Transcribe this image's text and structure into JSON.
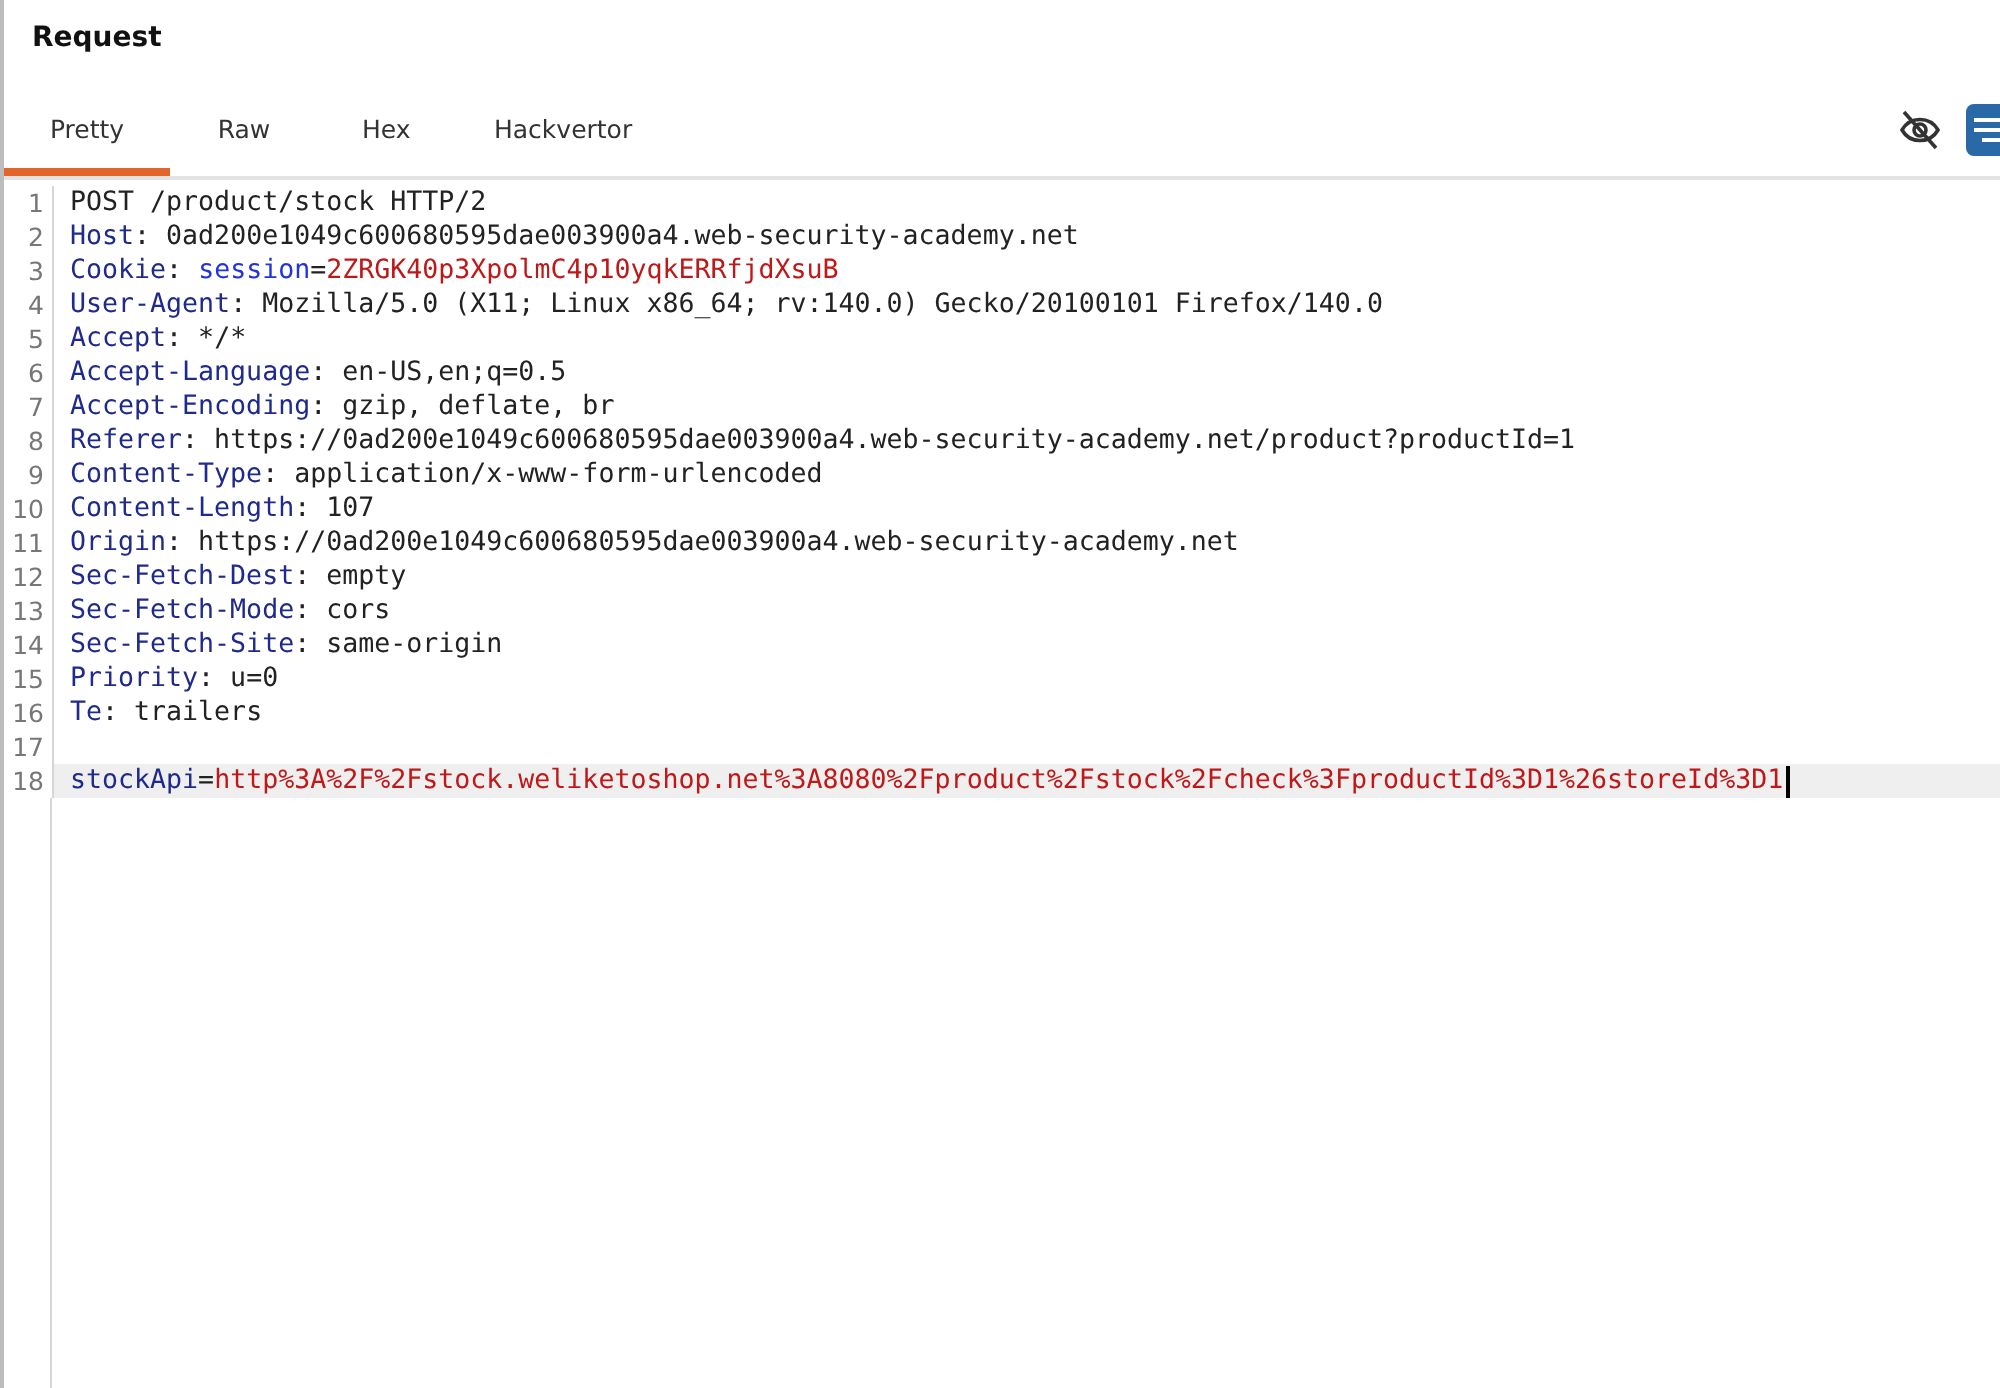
{
  "panel": {
    "title": "Request"
  },
  "tabs": [
    {
      "label": "Pretty",
      "selected": true
    },
    {
      "label": "Raw",
      "selected": false
    },
    {
      "label": "Hex",
      "selected": false
    },
    {
      "label": "Hackvertor",
      "selected": false
    }
  ],
  "editor": {
    "lines": [
      {
        "number": "1",
        "current": false,
        "segments": [
          {
            "kind": "plain",
            "text": "POST /product/stock HTTP/2"
          }
        ]
      },
      {
        "number": "2",
        "current": false,
        "segments": [
          {
            "kind": "name",
            "text": "Host"
          },
          {
            "kind": "plain",
            "text": ": 0ad200e1049c600680595dae003900a4.web-security-academy.net"
          }
        ]
      },
      {
        "number": "3",
        "current": false,
        "segments": [
          {
            "kind": "name",
            "text": "Cookie"
          },
          {
            "kind": "plain",
            "text": ": "
          },
          {
            "kind": "param",
            "text": "session"
          },
          {
            "kind": "plain",
            "text": "="
          },
          {
            "kind": "value",
            "text": "2ZRGK40p3XpolmC4p10yqkERRfjdXsuB"
          }
        ]
      },
      {
        "number": "4",
        "current": false,
        "segments": [
          {
            "kind": "name",
            "text": "User-Agent"
          },
          {
            "kind": "plain",
            "text": ": Mozilla/5.0 (X11; Linux x86_64; rv:140.0) Gecko/20100101 Firefox/140.0"
          }
        ]
      },
      {
        "number": "5",
        "current": false,
        "segments": [
          {
            "kind": "name",
            "text": "Accept"
          },
          {
            "kind": "plain",
            "text": ": */*"
          }
        ]
      },
      {
        "number": "6",
        "current": false,
        "segments": [
          {
            "kind": "name",
            "text": "Accept-Language"
          },
          {
            "kind": "plain",
            "text": ": en-US,en;q=0.5"
          }
        ]
      },
      {
        "number": "7",
        "current": false,
        "segments": [
          {
            "kind": "name",
            "text": "Accept-Encoding"
          },
          {
            "kind": "plain",
            "text": ": gzip, deflate, br"
          }
        ]
      },
      {
        "number": "8",
        "current": false,
        "segments": [
          {
            "kind": "name",
            "text": "Referer"
          },
          {
            "kind": "plain",
            "text": ": https://0ad200e1049c600680595dae003900a4.web-security-academy.net/product?productId=1"
          }
        ]
      },
      {
        "number": "9",
        "current": false,
        "segments": [
          {
            "kind": "name",
            "text": "Content-Type"
          },
          {
            "kind": "plain",
            "text": ": application/x-www-form-urlencoded"
          }
        ]
      },
      {
        "number": "10",
        "current": false,
        "segments": [
          {
            "kind": "name",
            "text": "Content-Length"
          },
          {
            "kind": "plain",
            "text": ": 107"
          }
        ]
      },
      {
        "number": "11",
        "current": false,
        "segments": [
          {
            "kind": "name",
            "text": "Origin"
          },
          {
            "kind": "plain",
            "text": ": https://0ad200e1049c600680595dae003900a4.web-security-academy.net"
          }
        ]
      },
      {
        "number": "12",
        "current": false,
        "segments": [
          {
            "kind": "name",
            "text": "Sec-Fetch-Dest"
          },
          {
            "kind": "plain",
            "text": ": empty"
          }
        ]
      },
      {
        "number": "13",
        "current": false,
        "segments": [
          {
            "kind": "name",
            "text": "Sec-Fetch-Mode"
          },
          {
            "kind": "plain",
            "text": ": cors"
          }
        ]
      },
      {
        "number": "14",
        "current": false,
        "segments": [
          {
            "kind": "name",
            "text": "Sec-Fetch-Site"
          },
          {
            "kind": "plain",
            "text": ": same-origin"
          }
        ]
      },
      {
        "number": "15",
        "current": false,
        "segments": [
          {
            "kind": "name",
            "text": "Priority"
          },
          {
            "kind": "plain",
            "text": ": u=0"
          }
        ]
      },
      {
        "number": "16",
        "current": false,
        "segments": [
          {
            "kind": "name",
            "text": "Te"
          },
          {
            "kind": "plain",
            "text": ": trailers"
          }
        ]
      },
      {
        "number": "17",
        "current": false
      },
      {
        "number": "18",
        "current": true,
        "segments": [
          {
            "kind": "name",
            "text": "stockApi"
          },
          {
            "kind": "plain",
            "text": "="
          },
          {
            "kind": "value",
            "text": "http%3A%2F%2Fstock.weliketoshop.net%3A8080%2Fproduct%2Fstock%2Fcheck%3FproductId%3D1%26storeId%3D1"
          }
        ]
      }
    ]
  }
}
